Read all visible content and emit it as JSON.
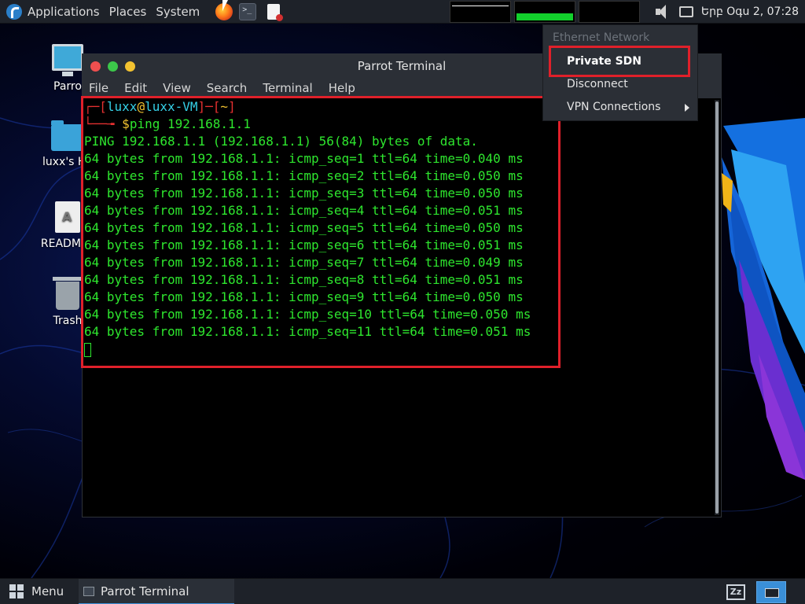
{
  "top_panel": {
    "applications": "Applications",
    "places": "Places",
    "system": "System",
    "clock": "Երբ Օգս  2, 07:28"
  },
  "desktop": {
    "icons": [
      {
        "label": "Parro",
        "icon": "computer-icon"
      },
      {
        "label": "luxx's Ho",
        "icon": "home-folder-icon"
      },
      {
        "label": "README.l",
        "icon": "document-icon"
      },
      {
        "label": "Trash",
        "icon": "trash-icon"
      }
    ]
  },
  "terminal": {
    "title": "Parrot Terminal",
    "menu": [
      "File",
      "Edit",
      "View",
      "Search",
      "Terminal",
      "Help"
    ],
    "prompt": {
      "bracket_open": "┌─[",
      "user": "luxx",
      "at": "@",
      "host": "luxx-VM",
      "mid": "]─[",
      "dir": "~",
      "bracket_close": "]",
      "line2_prefix": "└──╼ ",
      "dollar": "$",
      "command": "ping 192.168.1.1"
    },
    "output": [
      "PING 192.168.1.1 (192.168.1.1) 56(84) bytes of data.",
      "64 bytes from 192.168.1.1: icmp_seq=1 ttl=64 time=0.040 ms",
      "64 bytes from 192.168.1.1: icmp_seq=2 ttl=64 time=0.050 ms",
      "64 bytes from 192.168.1.1: icmp_seq=3 ttl=64 time=0.050 ms",
      "64 bytes from 192.168.1.1: icmp_seq=4 ttl=64 time=0.051 ms",
      "64 bytes from 192.168.1.1: icmp_seq=5 ttl=64 time=0.050 ms",
      "64 bytes from 192.168.1.1: icmp_seq=6 ttl=64 time=0.051 ms",
      "64 bytes from 192.168.1.1: icmp_seq=7 ttl=64 time=0.049 ms",
      "64 bytes from 192.168.1.1: icmp_seq=8 ttl=64 time=0.051 ms",
      "64 bytes from 192.168.1.1: icmp_seq=9 ttl=64 time=0.050 ms",
      "64 bytes from 192.168.1.1: icmp_seq=10 ttl=64 time=0.050 ms",
      "64 bytes from 192.168.1.1: icmp_seq=11 ttl=64 time=0.051 ms"
    ]
  },
  "network_menu": {
    "header": "Ethernet Network",
    "items": [
      "Private SDN",
      "Disconnect",
      "VPN Connections"
    ]
  },
  "taskbar": {
    "menu": "Menu",
    "task": "Parrot Terminal"
  },
  "colors": {
    "terminal_green": "#2ee62e",
    "prompt_red": "#e53030",
    "prompt_cyan": "#35d0e6",
    "highlight_red": "#e0202a",
    "panel_bg": "#1e2229"
  }
}
